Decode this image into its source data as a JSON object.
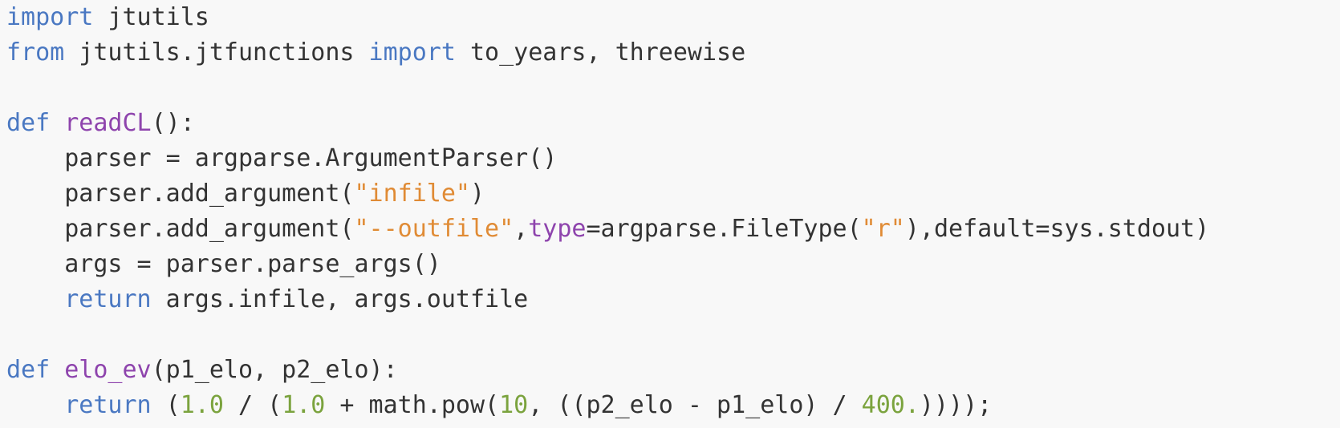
{
  "colors": {
    "background": "#f8f8f8",
    "keyword": "#4a78c2",
    "function_name": "#8e44ad",
    "string": "#e08b35",
    "number": "#7ba33e",
    "text": "#333333"
  },
  "code": {
    "lines": [
      {
        "tokens": [
          {
            "t": "kw",
            "v": "import"
          },
          {
            "t": "plain",
            "v": " jtutils"
          }
        ]
      },
      {
        "tokens": [
          {
            "t": "kw",
            "v": "from"
          },
          {
            "t": "plain",
            "v": " jtutils.jtfunctions "
          },
          {
            "t": "kw",
            "v": "import"
          },
          {
            "t": "plain",
            "v": " to_years, threewise"
          }
        ]
      },
      {
        "tokens": []
      },
      {
        "tokens": [
          {
            "t": "kw",
            "v": "def"
          },
          {
            "t": "plain",
            "v": " "
          },
          {
            "t": "fn",
            "v": "readCL"
          },
          {
            "t": "plain",
            "v": "():"
          }
        ]
      },
      {
        "tokens": [
          {
            "t": "plain",
            "v": "    parser = argparse.ArgumentParser()"
          }
        ]
      },
      {
        "tokens": [
          {
            "t": "plain",
            "v": "    parser.add_argument("
          },
          {
            "t": "str",
            "v": "\"infile\""
          },
          {
            "t": "plain",
            "v": ")"
          }
        ]
      },
      {
        "tokens": [
          {
            "t": "plain",
            "v": "    parser.add_argument("
          },
          {
            "t": "str",
            "v": "\"--outfile\""
          },
          {
            "t": "plain",
            "v": ","
          },
          {
            "t": "fn",
            "v": "type"
          },
          {
            "t": "plain",
            "v": "=argparse.FileType("
          },
          {
            "t": "str",
            "v": "\"r\""
          },
          {
            "t": "plain",
            "v": "),default=sys.stdout)"
          }
        ]
      },
      {
        "tokens": [
          {
            "t": "plain",
            "v": "    args = parser.parse_args()"
          }
        ]
      },
      {
        "tokens": [
          {
            "t": "plain",
            "v": "    "
          },
          {
            "t": "kw",
            "v": "return"
          },
          {
            "t": "plain",
            "v": " args.infile, args.outfile"
          }
        ]
      },
      {
        "tokens": []
      },
      {
        "tokens": [
          {
            "t": "kw",
            "v": "def"
          },
          {
            "t": "plain",
            "v": " "
          },
          {
            "t": "fn",
            "v": "elo_ev"
          },
          {
            "t": "plain",
            "v": "(p1_elo, p2_elo):"
          }
        ]
      },
      {
        "tokens": [
          {
            "t": "plain",
            "v": "    "
          },
          {
            "t": "kw",
            "v": "return"
          },
          {
            "t": "plain",
            "v": " ("
          },
          {
            "t": "num",
            "v": "1.0"
          },
          {
            "t": "plain",
            "v": " / ("
          },
          {
            "t": "num",
            "v": "1.0"
          },
          {
            "t": "plain",
            "v": " + math.pow("
          },
          {
            "t": "num",
            "v": "10"
          },
          {
            "t": "plain",
            "v": ", ((p2_elo - p1_elo) / "
          },
          {
            "t": "num",
            "v": "400."
          },
          {
            "t": "plain",
            "v": "))));"
          }
        ]
      }
    ]
  }
}
